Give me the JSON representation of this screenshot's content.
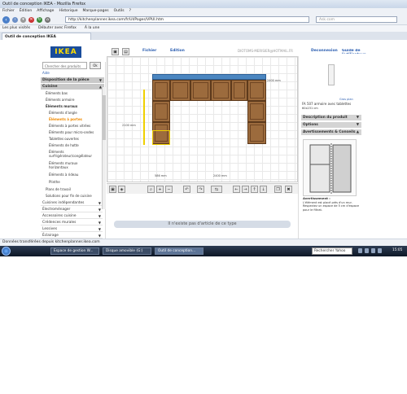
{
  "window": {
    "title": "Outil de conception IKEA - Mozilla Firefox",
    "menu": [
      "Fichier",
      "Édition",
      "Affichage",
      "Historique",
      "Marque-pages",
      "Outils",
      "?"
    ],
    "url": "http://kitchenplanner.ikea.com/fr/UI/Pages/VPUI.htm",
    "search_placeholder": "Ask.com",
    "bookmarks": [
      "Les plus visités",
      "Débuter avec Firefox",
      "À la une"
    ],
    "tab_title": "Outil de conception IKEA",
    "status": "Données transférées depuis kitchenplanner.ikea.com"
  },
  "app": {
    "logo": "IKEA",
    "search_placeholder": "Chercher des produits",
    "search_ok": "Ok",
    "help": "Aide",
    "menus": {
      "fichier": "Fichier",
      "edition": "Edition"
    },
    "user_email": "DIOTOMS-MERISIER@HOTMAIL.FR",
    "deconnexion": "Deconnexion",
    "guide": "Guide de l'utilisateur",
    "sidebar": {
      "disposition": "Disposition de la pièce",
      "cuisine": "Cuisine",
      "items": [
        "Éléments bas",
        "Éléments armoire",
        "Éléments muraux",
        "Éléments d'angle",
        "Éléments à portes",
        "Éléments à portes vitrées",
        "Éléments pour micro-ondes",
        "Tablettes ouvertes",
        "Éléments de hotte",
        "Éléments surfrigérateur/congélateur",
        "Éléments muraux horizontaux",
        "Éléments à rideau",
        "Plinthe",
        "Plans de travail",
        "Solutions pour fin de cuisine"
      ],
      "categories": [
        "Cuisines indépendantes",
        "Électroménager",
        "Accessoires cuisine",
        "Crédences murales",
        "Lessives",
        "Éclairage"
      ]
    },
    "dimensions": {
      "total_height": "2400 mm",
      "height": "2100 mm",
      "base_width": "586 mm",
      "width": "2400 mm"
    },
    "no_article": "Il n'existe pas d'article de ce type",
    "product": {
      "zoom_link": "Gros plan",
      "name": "FA 507 armoire avec tablettes",
      "size": "60x231 cm",
      "sections": [
        "Description du produit",
        "Options",
        "Avertissements & Conseils"
      ],
      "warning_title": "Avertissement :",
      "warning": "L'élément est placé près d'un mur. Respectez un espace de 5 cm d'espace pour le filtrat."
    }
  },
  "taskbar": {
    "tasks": [
      "Espace de gestion W...",
      "Disque amovible (G:)",
      "Outil de conception..."
    ],
    "search": "Rechercher Yahoo",
    "clock": "15:05"
  }
}
